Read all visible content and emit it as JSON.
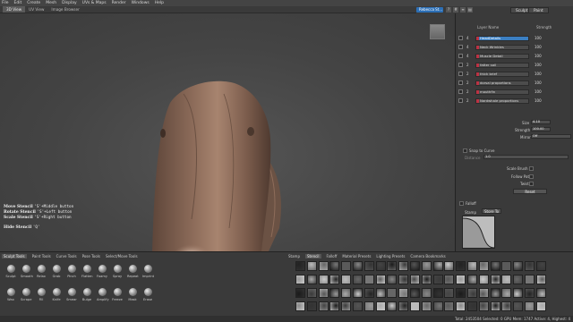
{
  "menu": [
    "File",
    "Edit",
    "Create",
    "Mesh",
    "Display",
    "UVs & Maps",
    "Render",
    "Windows",
    "Help"
  ],
  "view_tabs": [
    "3D View",
    "UV View",
    "Image Browser"
  ],
  "user": "Rebecca St...",
  "mode_buttons": [
    "Sculpt",
    "Paint"
  ],
  "viewcube_label": "",
  "layers": {
    "header": {
      "name": "Layer Name",
      "strength": "Strength"
    },
    "rows": [
      {
        "num": "4",
        "name": "HeadDetails",
        "value": "100",
        "selected": true
      },
      {
        "num": "4",
        "name": "Neck Wrinkles",
        "value": "100"
      },
      {
        "num": "4",
        "name": "Muscle Detail",
        "value": "100"
      },
      {
        "num": "2",
        "name": "fatter sail",
        "value": "100"
      },
      {
        "num": "2",
        "name": "thick brief",
        "value": "100"
      },
      {
        "num": "2",
        "name": "dorsal proportions",
        "value": "100"
      },
      {
        "num": "2",
        "name": "mouthfin",
        "value": "100"
      },
      {
        "num": "2",
        "name": "Nardwhale proportions",
        "value": "100"
      }
    ]
  },
  "props": {
    "size_label": "Size",
    "size_value": "4.10",
    "strength_label": "Strength",
    "strength_value": "100.00",
    "mirror_label": "Mirror",
    "mirror_value": "Off",
    "snap_label": "Snap to Curve",
    "distance_label": "Distance",
    "distance_value": "1.0",
    "scale_label": "Scale Brush",
    "follow_label": "Follow Path",
    "twist_label": "Twist",
    "reset_label": "Reset",
    "falloff_label": "Falloff",
    "stamp_label": "Stamp",
    "store_label": "Store To"
  },
  "stencil_help": [
    {
      "label": "Move Stencil",
      "key": "'S'+Middle button"
    },
    {
      "label": "Rotate Stencil",
      "key": "'S'+Left button"
    },
    {
      "label": "Scale Stencil",
      "key": "'S'+Right button"
    },
    {
      "label": "Hide Stencil",
      "key": "'Q'"
    }
  ],
  "tool_tabs": [
    "Sculpt Tools",
    "Paint Tools",
    "Curve Tools",
    "Pose Tools",
    "Select/Move Tools"
  ],
  "tools_row1": [
    "Sculpt",
    "Smooth",
    "Relax",
    "Grab",
    "Pinch",
    "Flatten",
    "Foamy",
    "Spray",
    "Repeat",
    "Imprint"
  ],
  "tools_row2": [
    "Wax",
    "Scrape",
    "Fill",
    "Knife",
    "Smear",
    "Bulge",
    "Amplify",
    "Freeze",
    "Mask",
    "Erase"
  ],
  "stamp_tabs": [
    "Stamp",
    "Stencil",
    "Falloff",
    "Material Presets",
    "Lighting Presets",
    "Camera Bookmarks"
  ],
  "status": "Total: 2453504  Selected: 0  GPU Mem: 1747  Active: 4, Highest: 4",
  "colors": {
    "accent": "#2c6fb6",
    "skin": "#8a6a58",
    "selected": "#3b7fc2"
  }
}
